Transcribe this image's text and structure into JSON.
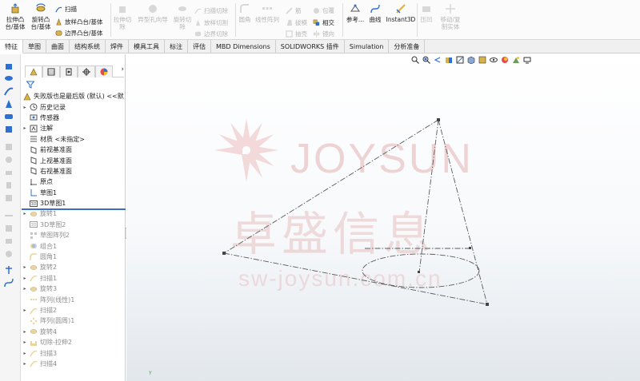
{
  "ribbon": {
    "extrude_boss": "拉伸凸\n台/基体",
    "revolve_boss": "旋转凸\n台/基体",
    "sweep": "扫描",
    "loft_boss": "放样凸台/基体",
    "boundary_boss": "边界凸台/基体",
    "extrude_cut": "拉伸切\n除",
    "hole_wizard": "异型孔向导",
    "revolve_cut": "旋转切\n除",
    "swept_cut": "扫描切除",
    "lofted_cut": "放样切割",
    "boundary_cut": "边界切除",
    "fillet": "圆角",
    "linear_pattern": "线性阵列",
    "rib": "筋",
    "draft": "拔模",
    "shell": "抽壳",
    "wrap": "包覆",
    "intersect": "相交",
    "mirror": "镜向",
    "reference": "参考...",
    "curves": "曲线",
    "instant3d": "Instant3D",
    "flex": "压凹",
    "move_copy": "移动/复\n制实体"
  },
  "tabs": [
    "特征",
    "草图",
    "曲面",
    "结构系统",
    "焊件",
    "模具工具",
    "标注",
    "评估",
    "MBD Dimensions",
    "SOLIDWORKS 插件",
    "Simulation",
    "分析准备"
  ],
  "feature_tree": {
    "root": "失败版也是最后版 (默认) <<默",
    "items": [
      {
        "label": "历史记录",
        "icon": "history-icon",
        "expand": "▸"
      },
      {
        "label": "传感器",
        "icon": "sensor-icon",
        "expand": ""
      },
      {
        "label": "注解",
        "icon": "annotation-icon",
        "expand": "▸"
      },
      {
        "label": "材质 <未指定>",
        "icon": "material-icon",
        "expand": ""
      },
      {
        "label": "前视基准面",
        "icon": "plane-icon",
        "expand": ""
      },
      {
        "label": "上视基准面",
        "icon": "plane-icon",
        "expand": ""
      },
      {
        "label": "右视基准面",
        "icon": "plane-icon",
        "expand": ""
      },
      {
        "label": "原点",
        "icon": "origin-icon",
        "expand": ""
      },
      {
        "label": "草图1",
        "icon": "sketch-icon",
        "expand": ""
      },
      {
        "label": "3D草图1",
        "icon": "3dsketch-icon",
        "expand": ""
      },
      {
        "label": "旋转1",
        "icon": "revolve-icon",
        "expand": "▸",
        "suppressed": true
      },
      {
        "label": "3D草图2",
        "icon": "3dsketch-icon",
        "expand": "",
        "suppressed": true
      },
      {
        "label": "草图阵列2",
        "icon": "pattern-icon",
        "expand": "",
        "suppressed": true
      },
      {
        "label": "组合1",
        "icon": "combine-icon",
        "expand": "",
        "suppressed": true
      },
      {
        "label": "圆角1",
        "icon": "fillet-icon",
        "expand": "",
        "suppressed": true
      },
      {
        "label": "旋转2",
        "icon": "revolve-icon",
        "expand": "▸",
        "suppressed": true
      },
      {
        "label": "扫描1",
        "icon": "sweep-icon",
        "expand": "▸",
        "suppressed": true
      },
      {
        "label": "旋转3",
        "icon": "revolve-icon",
        "expand": "▸",
        "suppressed": true
      },
      {
        "label": "阵列(线性)1",
        "icon": "linear-pattern-icon",
        "expand": "",
        "suppressed": true
      },
      {
        "label": "扫描2",
        "icon": "sweep-icon",
        "expand": "▸",
        "suppressed": true
      },
      {
        "label": "阵列(圆周)1",
        "icon": "circular-pattern-icon",
        "expand": "",
        "suppressed": true
      },
      {
        "label": "旋转4",
        "icon": "revolve-icon",
        "expand": "▸",
        "suppressed": true
      },
      {
        "label": "切除-拉伸2",
        "icon": "cut-extrude-icon",
        "expand": "▸",
        "suppressed": true
      },
      {
        "label": "扫描3",
        "icon": "sweep-icon",
        "expand": "▸",
        "suppressed": true
      },
      {
        "label": "扫描4",
        "icon": "sweep-icon",
        "expand": "▸",
        "suppressed": true
      }
    ]
  },
  "panel_next": "›",
  "watermark": {
    "brand": "JOYSUN",
    "chinese": "卓盛信息",
    "url": "sw-joysun.com.cn"
  },
  "triad_label": "Y",
  "colors": {
    "accent": "#3a6fc4",
    "watermark": "#e8b4b4",
    "sketch_line": "#5a5a5a"
  }
}
